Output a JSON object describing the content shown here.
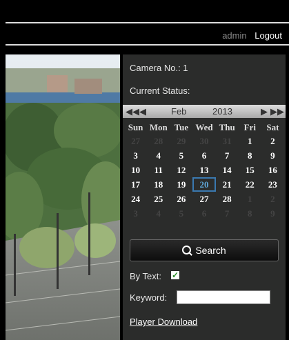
{
  "header": {
    "user": "admin",
    "logout_label": "Logout"
  },
  "panel": {
    "camera_label": "Camera No.: 1",
    "status_label": "Current Status:",
    "calendar": {
      "month": "Feb",
      "year": "2013",
      "weekdays": [
        "Sun",
        "Mon",
        "Tue",
        "Wed",
        "Thu",
        "Fri",
        "Sat"
      ],
      "weeks": [
        [
          "27",
          "28",
          "29",
          "30",
          "31",
          "1",
          "2"
        ],
        [
          "3",
          "4",
          "5",
          "6",
          "7",
          "8",
          "9"
        ],
        [
          "10",
          "11",
          "12",
          "13",
          "14",
          "15",
          "16"
        ],
        [
          "17",
          "18",
          "19",
          "20",
          "21",
          "22",
          "23"
        ],
        [
          "24",
          "25",
          "26",
          "27",
          "28",
          "1",
          "2"
        ],
        [
          "3",
          "4",
          "5",
          "6",
          "7",
          "8",
          "9"
        ]
      ],
      "selected_day": "20"
    },
    "search_label": "Search",
    "by_text_label": "By Text:",
    "by_text_checked": true,
    "keyword_label": "Keyword:",
    "keyword_value": "",
    "player_download_label": "Player Download"
  },
  "colors": {
    "panel_bg": "#2b2c2b",
    "selected_day": "#3a79b0",
    "checkbox": "#2a8f2a"
  }
}
